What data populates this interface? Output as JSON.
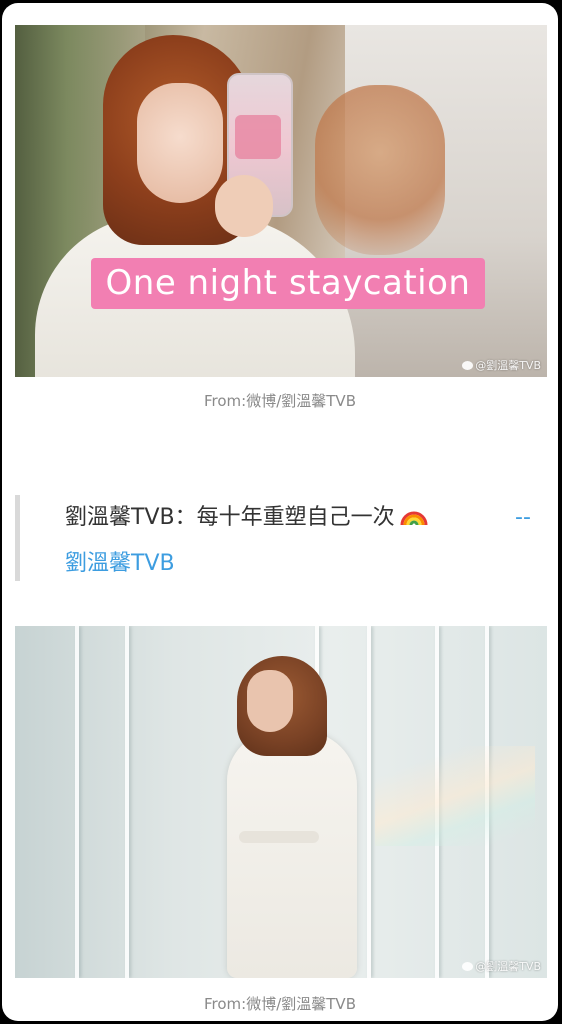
{
  "images": [
    {
      "banner_text": "One night staycation",
      "watermark": "@劉溫馨TVB",
      "caption": "From:微博/劉溫馨TVB"
    },
    {
      "watermark": "@劉溫馨TVB",
      "caption": "From:微博/劉溫馨TVB"
    }
  ],
  "quote": {
    "text": "劉溫馨TVB：每十年重塑自己一次",
    "emoji_icon": "rainbow-icon",
    "dash": "--",
    "author_link": "劉溫馨TVB"
  },
  "colors": {
    "banner_pink": "#f27fb2",
    "link_blue": "#3d9de0",
    "caption_gray": "#8a8a8a",
    "quote_bar": "#d9d9d9"
  }
}
